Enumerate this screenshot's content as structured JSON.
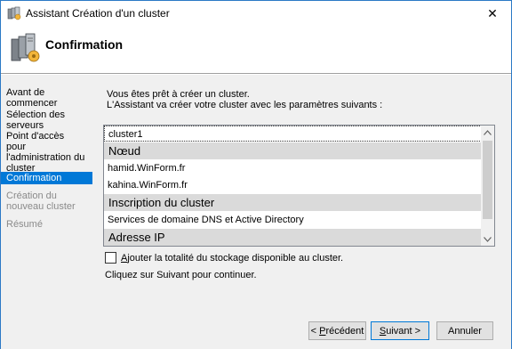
{
  "window": {
    "title": "Assistant Création d'un cluster",
    "close_glyph": "✕",
    "icon": "cluster-wizard-icon"
  },
  "header": {
    "title": "Confirmation",
    "icon": "server-cluster-icon"
  },
  "nav": {
    "items": [
      {
        "label": "Avant de commencer",
        "state": "normal"
      },
      {
        "label": "Sélection des serveurs",
        "state": "normal"
      },
      {
        "label": "Point d'accès pour l'administration du cluster",
        "state": "normal"
      },
      {
        "label": "Confirmation",
        "state": "active"
      },
      {
        "label": "Création du nouveau cluster",
        "state": "disabled"
      },
      {
        "label": "Résumé",
        "state": "disabled"
      }
    ]
  },
  "content": {
    "intro_line1": "Vous êtes prêt à créer un cluster.",
    "intro_line2": "L'Assistant va créer votre cluster avec les paramètres suivants :",
    "list": {
      "rows": [
        {
          "text": "cluster1",
          "kind": "item"
        },
        {
          "text": "Nœud",
          "kind": "header"
        },
        {
          "text": "hamid.WinForm.fr",
          "kind": "item"
        },
        {
          "text": "kahina.WinForm.fr",
          "kind": "item"
        },
        {
          "text": "Inscription du cluster",
          "kind": "header"
        },
        {
          "text": "Services de domaine DNS et Active Directory",
          "kind": "item"
        },
        {
          "text": "Adresse IP",
          "kind": "header"
        }
      ]
    },
    "checkbox": {
      "label_underlined": "A",
      "label_rest": "jouter la totalité du stockage disponible au cluster.",
      "checked": false
    },
    "hint": "Cliquez sur Suivant pour continuer."
  },
  "buttons": {
    "previous": {
      "prefix": "< ",
      "underlined": "P",
      "rest": "récédent"
    },
    "next": {
      "underlined": "S",
      "rest": "uivant >"
    },
    "cancel": {
      "label": "Annuler"
    }
  },
  "colors": {
    "accent": "#0078d7",
    "window_border": "#2b79c6",
    "body_bg": "#f0f0f0",
    "list_header_bg": "#dadada"
  }
}
